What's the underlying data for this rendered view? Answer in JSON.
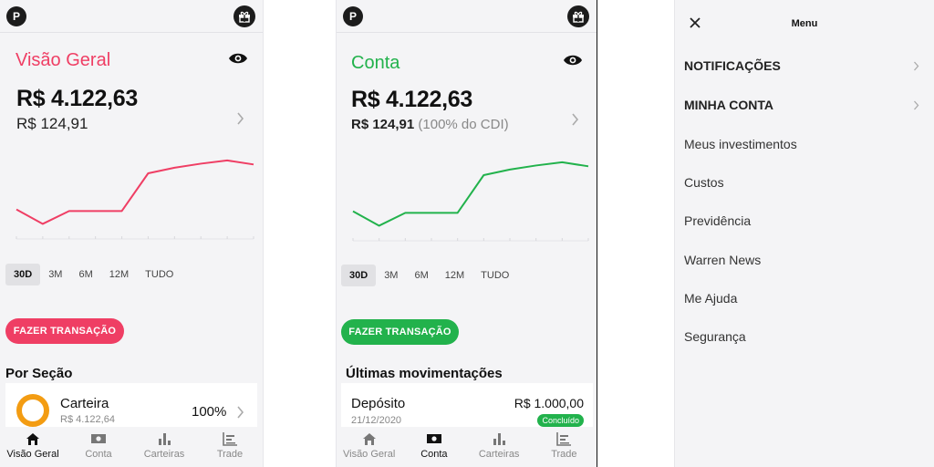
{
  "screens": {
    "overview": {
      "avatar_letter": "P",
      "title": "Visão Geral",
      "balance": "R$ 4.122,63",
      "sub_balance": "R$ 124,91",
      "periods": [
        "30D",
        "3M",
        "6M",
        "12M",
        "TUDO"
      ],
      "active_period": "30D",
      "cta": "FAZER TRANSAÇÃO",
      "section_heading": "Por Seção",
      "card": {
        "name": "Carteira",
        "amount": "R$ 4.122,64",
        "percent": "100%"
      },
      "accent": "#ef3e64",
      "chart_data": {
        "type": "line",
        "series": [
          {
            "values": [
              30,
              12,
              28,
              28,
              28,
              75,
              82,
              87,
              91,
              86
            ]
          }
        ],
        "ylim": [
          0,
          100
        ],
        "grid": false
      }
    },
    "account": {
      "avatar_letter": "P",
      "title": "Conta",
      "balance": "R$ 4.122,63",
      "sub_balance": "R$ 124,91",
      "sub_balance_note": "(100% do CDI)",
      "periods": [
        "30D",
        "3M",
        "6M",
        "12M",
        "TUDO"
      ],
      "active_period": "30D",
      "cta": "FAZER TRANSAÇÃO",
      "section_heading": "Últimas movimentações",
      "movement": {
        "name": "Depósito",
        "amount": "R$ 1.000,00",
        "date": "21/12/2020",
        "status": "Concluído"
      },
      "accent": "#22b24c",
      "chart_data": {
        "type": "line",
        "series": [
          {
            "values": [
              30,
              12,
              28,
              28,
              28,
              75,
              82,
              87,
              91,
              86
            ]
          }
        ],
        "ylim": [
          0,
          100
        ],
        "grid": false
      }
    },
    "menu": {
      "title": "Menu",
      "items": [
        {
          "label": "NOTIFICAÇÕES",
          "bold": true,
          "chevron": true
        },
        {
          "label": "MINHA CONTA",
          "bold": true,
          "chevron": true
        },
        {
          "label": "Meus investimentos",
          "bold": false,
          "chevron": false
        },
        {
          "label": "Custos",
          "bold": false,
          "chevron": false
        },
        {
          "label": "Previdência",
          "bold": false,
          "chevron": false
        },
        {
          "label": "Warren News",
          "bold": false,
          "chevron": false
        },
        {
          "label": "Me Ajuda",
          "bold": false,
          "chevron": false
        },
        {
          "label": "Segurança",
          "bold": false,
          "chevron": false
        }
      ]
    }
  },
  "tabbar": {
    "tabs": [
      {
        "label": "Visão Geral",
        "icon": "home-icon"
      },
      {
        "label": "Conta",
        "icon": "cash-icon"
      },
      {
        "label": "Carteiras",
        "icon": "bar-chart-icon"
      },
      {
        "label": "Trade",
        "icon": "trade-chart-icon"
      }
    ]
  }
}
